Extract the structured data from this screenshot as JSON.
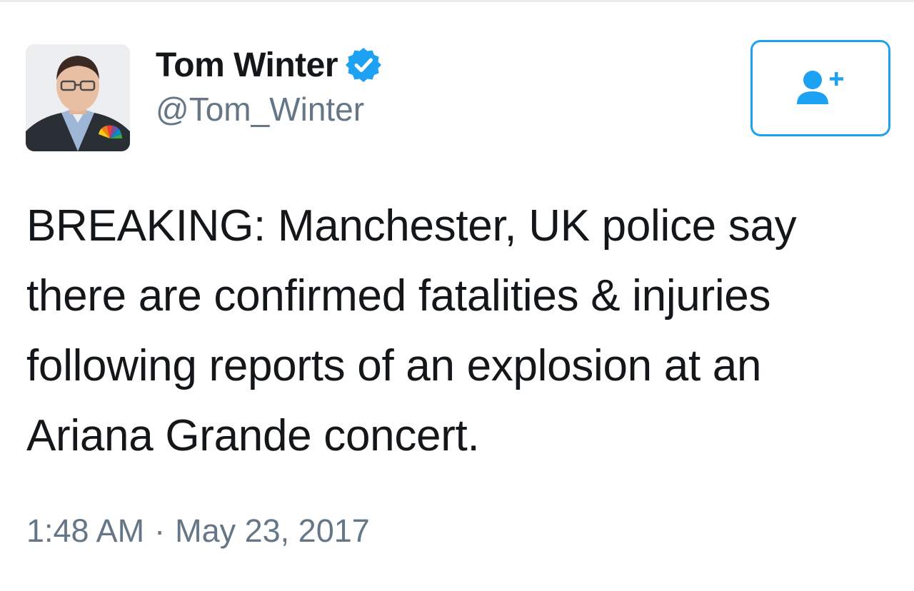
{
  "tweet": {
    "author": {
      "display_name": "Tom Winter",
      "handle": "@Tom_Winter",
      "verified": true,
      "avatar_icon": "profile-photo"
    },
    "follow_button": {
      "icon": "add-user-icon"
    },
    "text": "BREAKING: Manchester, UK police say\nthere are confirmed fatalities & injuries\nfollowing reports of an explosion at an\nAriana Grande concert.",
    "time": "1:48 AM",
    "separator": "·",
    "date": "May 23, 2017"
  },
  "colors": {
    "accent": "#1da1f2",
    "text": "#14171a",
    "secondary_text": "#657786"
  }
}
